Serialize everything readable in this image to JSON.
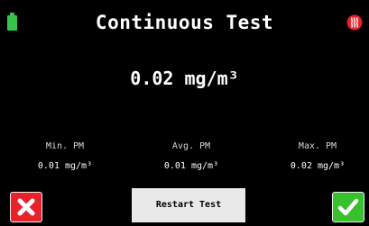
{
  "header": {
    "title": "Continuous Test",
    "battery_icon": "battery-icon",
    "heater_icon": "heater-icon"
  },
  "main": {
    "current_reading": "0.02 mg/m³"
  },
  "stats": {
    "min": {
      "label": "Min. PM",
      "value": "0.01 mg/m³"
    },
    "avg": {
      "label": "Avg. PM",
      "value": "0.01 mg/m³"
    },
    "max": {
      "label": "Max. PM",
      "value": "0.02 mg/m³"
    }
  },
  "buttons": {
    "restart_label": "Restart Test",
    "cancel_icon": "close-icon",
    "confirm_icon": "check-icon"
  },
  "colors": {
    "background": "#000000",
    "battery": "#37c24a",
    "cancel": "#e8222b",
    "confirm": "#39c02d",
    "heater": "#e8222b",
    "restart_button": "#e9e9e9"
  }
}
